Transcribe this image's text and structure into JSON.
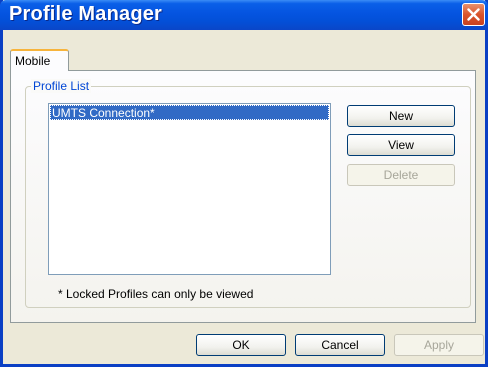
{
  "window": {
    "title": "Profile Manager"
  },
  "tabs": [
    {
      "label": "Mobile",
      "selected": true
    }
  ],
  "profile_group": {
    "legend": "Profile List",
    "items": [
      {
        "label": "UMTS Connection*",
        "selected": true
      }
    ],
    "note": "* Locked Profiles can only be viewed"
  },
  "actions": {
    "new_label": "New",
    "view_label": "View",
    "delete_label": "Delete",
    "delete_enabled": false
  },
  "footer": {
    "ok_label": "OK",
    "cancel_label": "Cancel",
    "apply_label": "Apply",
    "apply_enabled": false
  },
  "colors": {
    "titlebar": "#0554e0",
    "selection": "#316ac5",
    "legend_text": "#0046d5",
    "close_button": "#d9542c"
  },
  "icons": {
    "close": "close-icon"
  }
}
